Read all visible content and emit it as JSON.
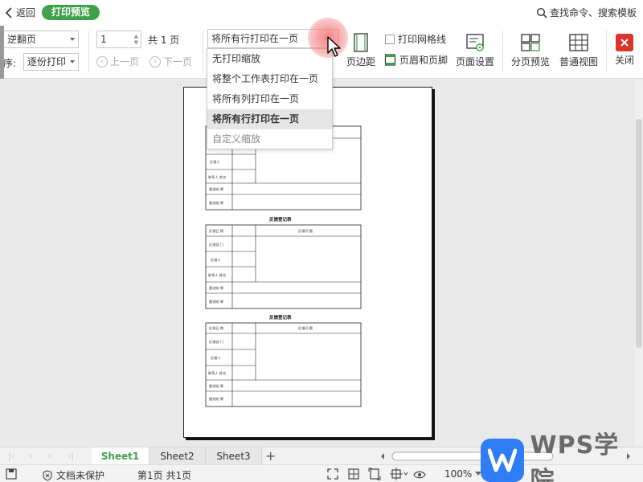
{
  "header": {
    "back_label": "返回",
    "mode_label": "打印预览",
    "search_label": "查找命令、搜索模板"
  },
  "toolbar": {
    "page_order_value": "逆翻页",
    "order_label": "序:",
    "collate_value": "逐份打印",
    "page_input_value": "1",
    "total_label": "共 1 页",
    "prev_label": "上一页",
    "next_label": "下一页",
    "scale_value": "将所有行打印在一页",
    "margins_label": "页边距",
    "gridlines_label": "打印网格线",
    "header_footer_label": "页眉和页脚",
    "page_setup_label": "页面设置",
    "page_break_label": "分页预览",
    "normal_view_label": "普通视图",
    "close_label": "关闭"
  },
  "scale_dropdown": {
    "options": [
      {
        "label": "无打印缩放"
      },
      {
        "label": "将整个工作表打印在一页"
      },
      {
        "label": "将所有列打印在一页"
      },
      {
        "label": "将所有行打印在一页"
      },
      {
        "label": "自定义缩放"
      }
    ],
    "selected_index": 3
  },
  "preview": {
    "form_title": "反馈登记表",
    "cells": {
      "date": "反馈日 期",
      "issue": "反馈问 题",
      "dept": "反馈部 门",
      "person": "反馈人",
      "contact": "联系人 姓名",
      "result": "跟进结 果",
      "note": "跟进结 果"
    }
  },
  "sheets": {
    "tabs": [
      "Sheet1",
      "Sheet2",
      "Sheet3"
    ],
    "active_index": 0,
    "add_label": "+"
  },
  "status": {
    "protect_label": "文档未保护",
    "page_info": "第1页 共1页",
    "zoom_value": "100%"
  },
  "brand": {
    "watermark_text": "WPS学院",
    "accent_color": "#3fa149",
    "close_color": "#d9352b",
    "logo_color": "#2e7cf6"
  }
}
